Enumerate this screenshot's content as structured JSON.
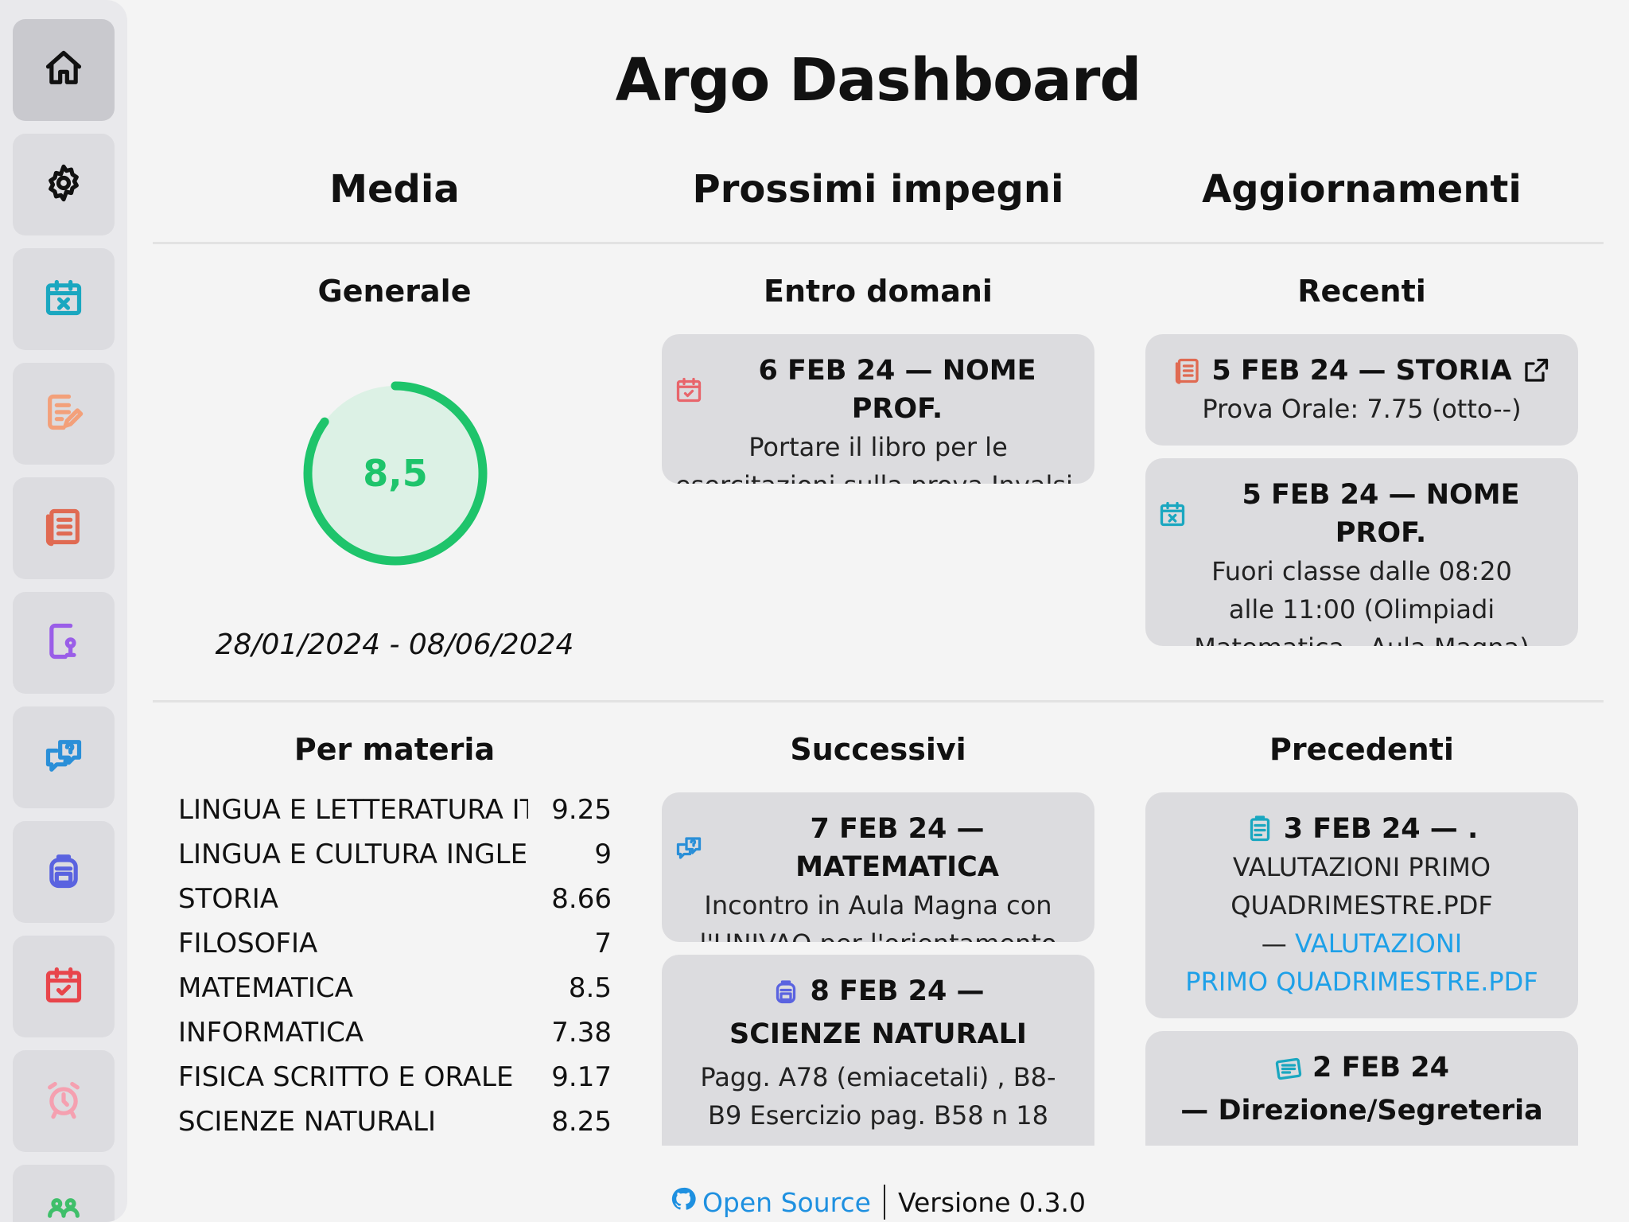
{
  "app": {
    "title": "Argo Dashboard"
  },
  "sidebar": {
    "items": [
      {
        "name": "home-icon",
        "color": "#111111",
        "active": true
      },
      {
        "name": "gear-icon",
        "color": "#111111"
      },
      {
        "name": "calendar-x-icon",
        "color": "#1aa7c0"
      },
      {
        "name": "document-edit-icon",
        "color": "#f3a07a"
      },
      {
        "name": "grades-document-icon",
        "color": "#e06a52"
      },
      {
        "name": "document-person-icon",
        "color": "#9a5ee8"
      },
      {
        "name": "chat-question-icon",
        "color": "#2a8fd8"
      },
      {
        "name": "backpack-icon",
        "color": "#5a63e0"
      },
      {
        "name": "calendar-check-icon",
        "color": "#e8454b"
      },
      {
        "name": "alarm-clock-icon",
        "color": "#f5a0b0"
      },
      {
        "name": "people-icon",
        "color": "#3fbf6a"
      }
    ]
  },
  "columns": {
    "media": "Media",
    "impegni": "Prossimi impegni",
    "aggiornamenti": "Aggiornamenti"
  },
  "media": {
    "generale_title": "Generale",
    "average": "8,5",
    "average_fraction": 0.85,
    "gauge_color": "#1ec46b",
    "period": "28/01/2024 - 08/06/2024",
    "per_materia_title": "Per materia",
    "subjects": [
      {
        "name": "LINGUA E LETTERATURA ITALIANA",
        "value": "9.25"
      },
      {
        "name": "LINGUA E CULTURA INGLESE",
        "value": "9"
      },
      {
        "name": "STORIA",
        "value": "8.66"
      },
      {
        "name": "FILOSOFIA",
        "value": "7"
      },
      {
        "name": "MATEMATICA",
        "value": "8.5"
      },
      {
        "name": "INFORMATICA",
        "value": "7.38"
      },
      {
        "name": "FISICA SCRITTO E ORALE",
        "value": "9.17"
      },
      {
        "name": "SCIENZE NATURALI",
        "value": "8.25"
      }
    ]
  },
  "impegni": {
    "entro_title": "Entro domani",
    "entro": [
      {
        "icon": "calendar-check-icon",
        "head": "6 FEB 24 — NOME PROF.",
        "body": [
          "Portare il libro per le",
          "esercitazioni sulla prova Invalsi."
        ]
      }
    ],
    "successivi_title": "Successivi",
    "successivi": [
      {
        "icon": "chat-question-icon",
        "head": "7 FEB 24 — MATEMATICA",
        "body": [
          "Incontro in Aula Magna con",
          "l'UNIVAQ per l'orientamento"
        ]
      },
      {
        "icon": "backpack-icon",
        "head": "8 FEB 24 —",
        "head2": "SCIENZE NATURALI",
        "body": [
          "Pagg. A78 (emiacetali) , B8-",
          "B9 Esercizio pag. B58 n 18"
        ]
      }
    ]
  },
  "aggiornamenti": {
    "recenti_title": "Recenti",
    "recenti": [
      {
        "icon": "grades-document-icon",
        "head": "5 FEB 24 — STORIA",
        "body": [
          "Prova Orale: 7.75 (otto--)"
        ]
      },
      {
        "icon": "calendar-x-icon",
        "head": "5 FEB 24 — NOME PROF.",
        "body": [
          "Fuori classe dalle 08:20",
          "alle 11:00 (Olimpiadi",
          "Matematica - Aula Magna)"
        ]
      }
    ],
    "precedenti_title": "Precedenti",
    "precedenti": [
      {
        "icon": "clipboard-icon",
        "head": "3 FEB 24 — .",
        "body": [
          "VALUTAZIONI PRIMO",
          "QUADRIMESTRE.PDF"
        ],
        "link_prefix": "—",
        "link": [
          "VALUTAZIONI",
          "PRIMO QUADRIMESTRE.PDF"
        ]
      },
      {
        "icon": "notice-board-icon",
        "head": "2 FEB 24",
        "head2": "— Direzione/Segreteria"
      }
    ]
  },
  "footer": {
    "open_source": "Open Source",
    "version": "Versione 0.3.0"
  }
}
